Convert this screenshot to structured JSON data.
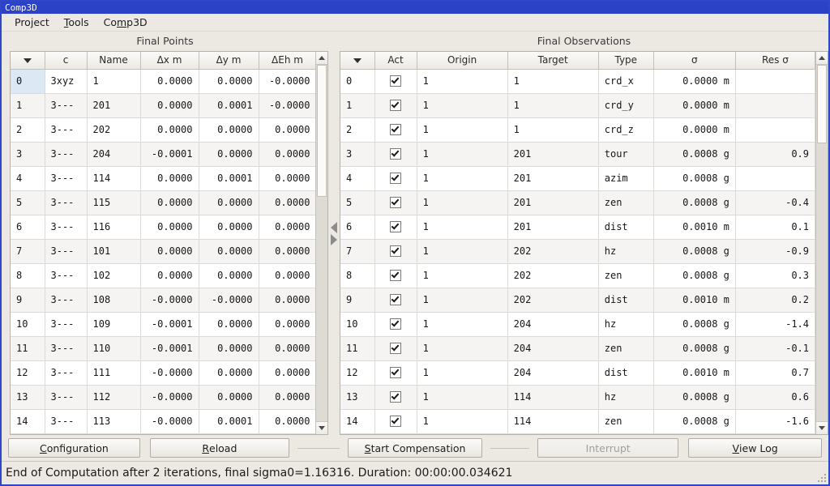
{
  "window": {
    "title": "Comp3D"
  },
  "menu": {
    "items": [
      {
        "label": "Project",
        "pre": "Pro",
        "mnemonic": "j",
        "post": "ect"
      },
      {
        "label": "Tools",
        "pre": "",
        "mnemonic": "T",
        "post": "ools"
      },
      {
        "label": "Comp3D",
        "pre": "Co",
        "mnemonic": "m",
        "post": "p3D"
      }
    ]
  },
  "left_panel": {
    "title": "Final Points",
    "columns": [
      "",
      "c",
      "Name",
      "Δx m",
      "Δy m",
      "ΔEh m"
    ],
    "sort_column_index": 0,
    "rows": [
      {
        "idx": "0",
        "c": "3xyz",
        "name": "1",
        "dx": "0.0000",
        "dy": "0.0000",
        "deh": "-0.0000",
        "selected": true
      },
      {
        "idx": "1",
        "c": "3---",
        "name": "201",
        "dx": "0.0000",
        "dy": "0.0001",
        "deh": "-0.0000",
        "selected": false
      },
      {
        "idx": "2",
        "c": "3---",
        "name": "202",
        "dx": "0.0000",
        "dy": "0.0000",
        "deh": "0.0000",
        "selected": false
      },
      {
        "idx": "3",
        "c": "3---",
        "name": "204",
        "dx": "-0.0001",
        "dy": "0.0000",
        "deh": "0.0000",
        "selected": false
      },
      {
        "idx": "4",
        "c": "3---",
        "name": "114",
        "dx": "0.0000",
        "dy": "0.0001",
        "deh": "0.0000",
        "selected": false
      },
      {
        "idx": "5",
        "c": "3---",
        "name": "115",
        "dx": "0.0000",
        "dy": "0.0000",
        "deh": "0.0000",
        "selected": false
      },
      {
        "idx": "6",
        "c": "3---",
        "name": "116",
        "dx": "0.0000",
        "dy": "0.0000",
        "deh": "0.0000",
        "selected": false
      },
      {
        "idx": "7",
        "c": "3---",
        "name": "101",
        "dx": "0.0000",
        "dy": "0.0000",
        "deh": "0.0000",
        "selected": false
      },
      {
        "idx": "8",
        "c": "3---",
        "name": "102",
        "dx": "0.0000",
        "dy": "0.0000",
        "deh": "0.0000",
        "selected": false
      },
      {
        "idx": "9",
        "c": "3---",
        "name": "108",
        "dx": "-0.0000",
        "dy": "-0.0000",
        "deh": "0.0000",
        "selected": false
      },
      {
        "idx": "10",
        "c": "3---",
        "name": "109",
        "dx": "-0.0001",
        "dy": "0.0000",
        "deh": "0.0000",
        "selected": false
      },
      {
        "idx": "11",
        "c": "3---",
        "name": "110",
        "dx": "-0.0001",
        "dy": "0.0000",
        "deh": "0.0000",
        "selected": false
      },
      {
        "idx": "12",
        "c": "3---",
        "name": "111",
        "dx": "-0.0000",
        "dy": "0.0000",
        "deh": "0.0000",
        "selected": false
      },
      {
        "idx": "13",
        "c": "3---",
        "name": "112",
        "dx": "-0.0000",
        "dy": "0.0000",
        "deh": "0.0000",
        "selected": false
      },
      {
        "idx": "14",
        "c": "3---",
        "name": "113",
        "dx": "-0.0000",
        "dy": "0.0001",
        "deh": "0.0000",
        "selected": false
      }
    ]
  },
  "right_panel": {
    "title": "Final Observations",
    "columns": [
      "",
      "Act",
      "Origin",
      "Target",
      "Type",
      "σ",
      "Res σ"
    ],
    "sort_column_index": 0,
    "rows": [
      {
        "idx": "0",
        "act": true,
        "origin": "1",
        "target": "1",
        "type": "crd_x",
        "sigma": "0.0000 m",
        "res": ""
      },
      {
        "idx": "1",
        "act": true,
        "origin": "1",
        "target": "1",
        "type": "crd_y",
        "sigma": "0.0000 m",
        "res": ""
      },
      {
        "idx": "2",
        "act": true,
        "origin": "1",
        "target": "1",
        "type": "crd_z",
        "sigma": "0.0000 m",
        "res": ""
      },
      {
        "idx": "3",
        "act": true,
        "origin": "1",
        "target": "201",
        "type": "tour",
        "sigma": "0.0008 g",
        "res": "0.9"
      },
      {
        "idx": "4",
        "act": true,
        "origin": "1",
        "target": "201",
        "type": "azim",
        "sigma": "0.0008 g",
        "res": ""
      },
      {
        "idx": "5",
        "act": true,
        "origin": "1",
        "target": "201",
        "type": "zen",
        "sigma": "0.0008 g",
        "res": "-0.4"
      },
      {
        "idx": "6",
        "act": true,
        "origin": "1",
        "target": "201",
        "type": "dist",
        "sigma": "0.0010 m",
        "res": "0.1"
      },
      {
        "idx": "7",
        "act": true,
        "origin": "1",
        "target": "202",
        "type": "hz",
        "sigma": "0.0008 g",
        "res": "-0.9"
      },
      {
        "idx": "8",
        "act": true,
        "origin": "1",
        "target": "202",
        "type": "zen",
        "sigma": "0.0008 g",
        "res": "0.3"
      },
      {
        "idx": "9",
        "act": true,
        "origin": "1",
        "target": "202",
        "type": "dist",
        "sigma": "0.0010 m",
        "res": "0.2"
      },
      {
        "idx": "10",
        "act": true,
        "origin": "1",
        "target": "204",
        "type": "hz",
        "sigma": "0.0008 g",
        "res": "-1.4"
      },
      {
        "idx": "11",
        "act": true,
        "origin": "1",
        "target": "204",
        "type": "zen",
        "sigma": "0.0008 g",
        "res": "-0.1"
      },
      {
        "idx": "12",
        "act": true,
        "origin": "1",
        "target": "204",
        "type": "dist",
        "sigma": "0.0010 m",
        "res": "0.7"
      },
      {
        "idx": "13",
        "act": true,
        "origin": "1",
        "target": "114",
        "type": "hz",
        "sigma": "0.0008 g",
        "res": "0.6"
      },
      {
        "idx": "14",
        "act": true,
        "origin": "1",
        "target": "114",
        "type": "zen",
        "sigma": "0.0008 g",
        "res": "-1.6"
      }
    ]
  },
  "buttons": {
    "configuration": {
      "pre": "",
      "mnemonic": "C",
      "post": "onfiguration",
      "enabled": true
    },
    "reload": {
      "pre": "",
      "mnemonic": "R",
      "post": "eload",
      "enabled": true
    },
    "start": {
      "pre": "",
      "mnemonic": "S",
      "post": "tart Compensation",
      "enabled": true
    },
    "interrupt": {
      "pre": "Interrupt",
      "mnemonic": "",
      "post": "",
      "enabled": false
    },
    "viewlog": {
      "pre": "",
      "mnemonic": "V",
      "post": "iew Log",
      "enabled": true
    }
  },
  "statusbar": {
    "text": "End of Computation after 2 iterations, final sigma0=1.16316. Duration: 00:00:00.034621"
  },
  "colors": {
    "title_bar": "#2b42c6",
    "window_bg": "#ece9e3",
    "selection": "#dce9f5",
    "row_alt": "#f5f4f2"
  }
}
